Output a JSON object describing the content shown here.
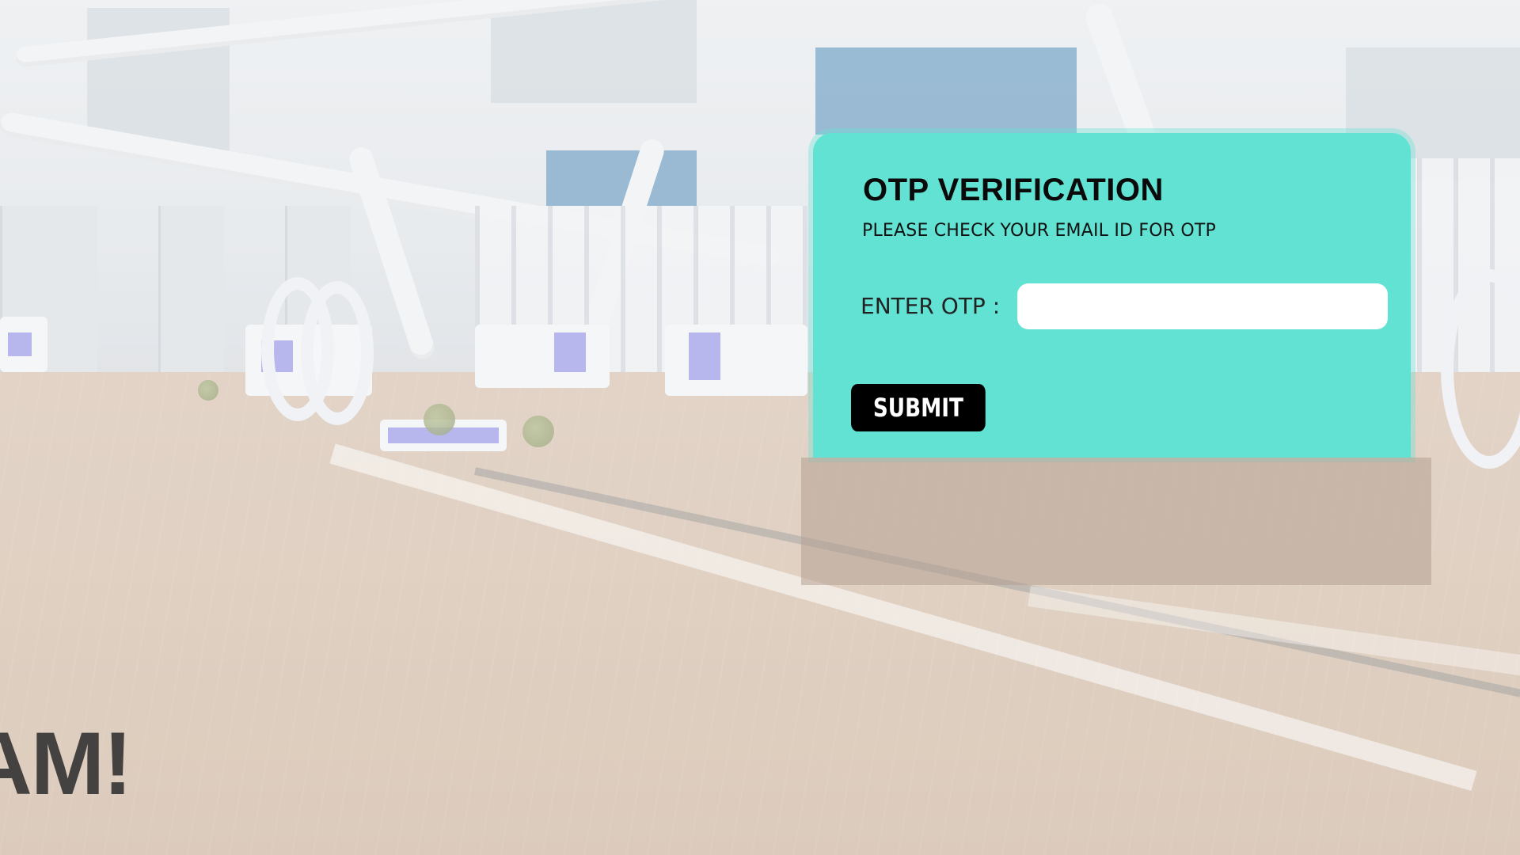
{
  "otp": {
    "title": "OTP VERIFICATION",
    "subtitle": "PLEASE CHECK YOUR EMAIL ID FOR OTP",
    "label": "ENTER OTP :",
    "input_value": "",
    "input_placeholder": "",
    "submit_label": "SUBMIT"
  },
  "background": {
    "partial_text": "AM!"
  },
  "colors": {
    "panel": "#61e2d3",
    "button": "#000000",
    "button_text": "#ffffff",
    "input_bg": "#ffffff"
  }
}
